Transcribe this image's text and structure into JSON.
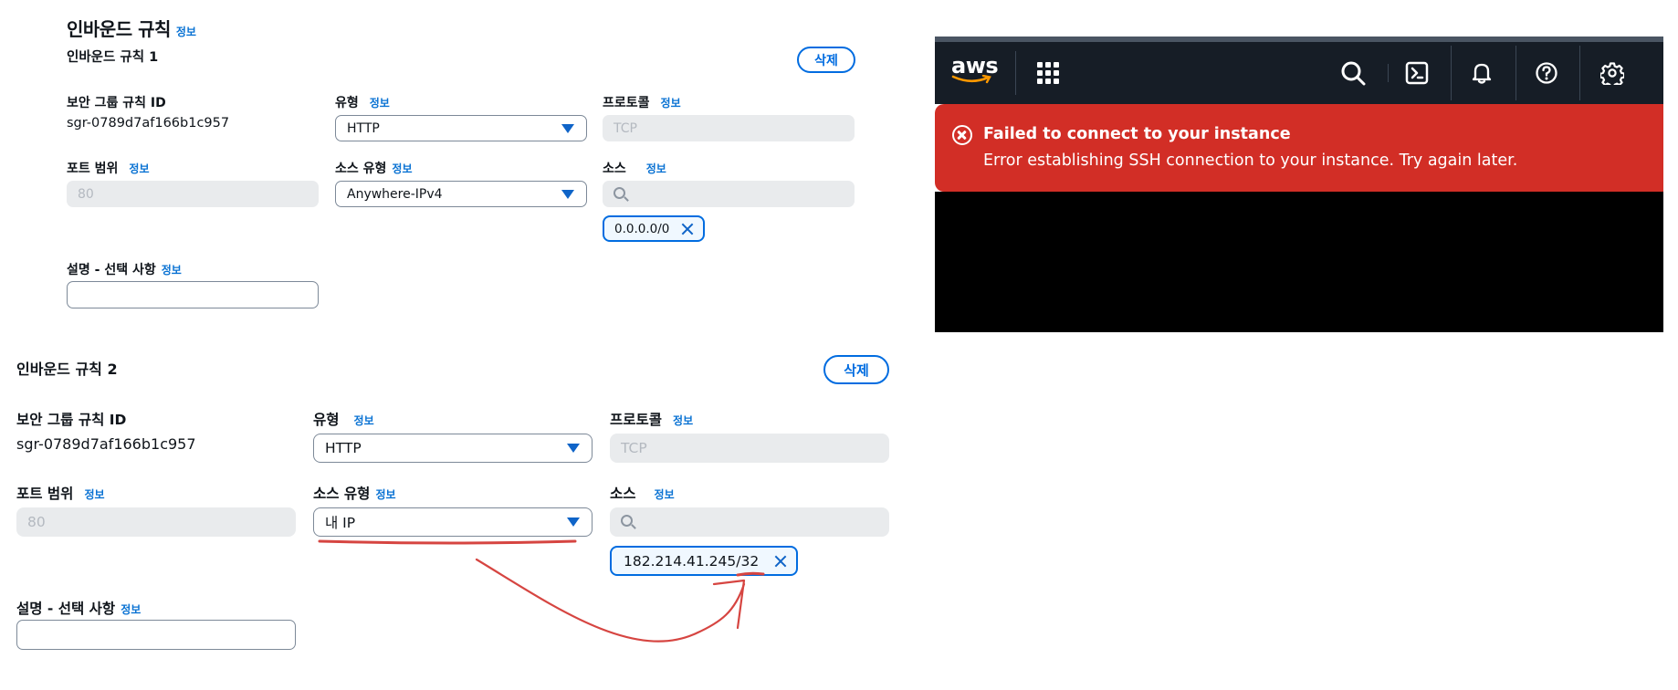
{
  "inbound": {
    "title": "인바운드 규칙",
    "info": "정보"
  },
  "rule1": {
    "title": "인바운드 규칙 1",
    "delete_label": "삭제",
    "sg_rule_id_label": "보안 그룹 규칙 ID",
    "sg_rule_id_value": "sgr-0789d7af166b1c957",
    "type_label": "유형",
    "type_value": "HTTP",
    "protocol_label": "프로토콜",
    "protocol_value": "TCP",
    "port_label": "포트 범위",
    "port_value": "80",
    "source_type_label": "소스 유형",
    "source_type_value": "Anywhere-IPv4",
    "source_label": "소스",
    "source_token": "0.0.0.0/0",
    "desc_label": "설명 - 선택 사항",
    "info": "정보"
  },
  "rule2": {
    "title": "인바운드 규칙 2",
    "delete_label": "삭제",
    "sg_rule_id_label": "보안 그룹 규칙 ID",
    "sg_rule_id_value": "sgr-0789d7af166b1c957",
    "type_label": "유형",
    "type_value": "HTTP",
    "protocol_label": "프로토콜",
    "protocol_value": "TCP",
    "port_label": "포트 범위",
    "port_value": "80",
    "source_type_label": "소스 유형",
    "source_type_value": "내 IP",
    "source_label": "소스",
    "source_token": "182.214.41.245/32",
    "desc_label": "설명 - 선택 사항",
    "info": "정보"
  },
  "aws": {
    "logo": "aws",
    "icons": [
      "apps-grid-icon",
      "search-icon",
      "cloudshell-icon",
      "bell-icon",
      "help-icon",
      "gear-icon"
    ],
    "error_title": "Failed to connect to your instance",
    "error_message": "Error establishing SSH connection to your instance. Try again later.",
    "colors": {
      "nav": "#161d26",
      "error": "#d22e26",
      "accent": "#006ce0",
      "annotation": "#d64541"
    }
  }
}
